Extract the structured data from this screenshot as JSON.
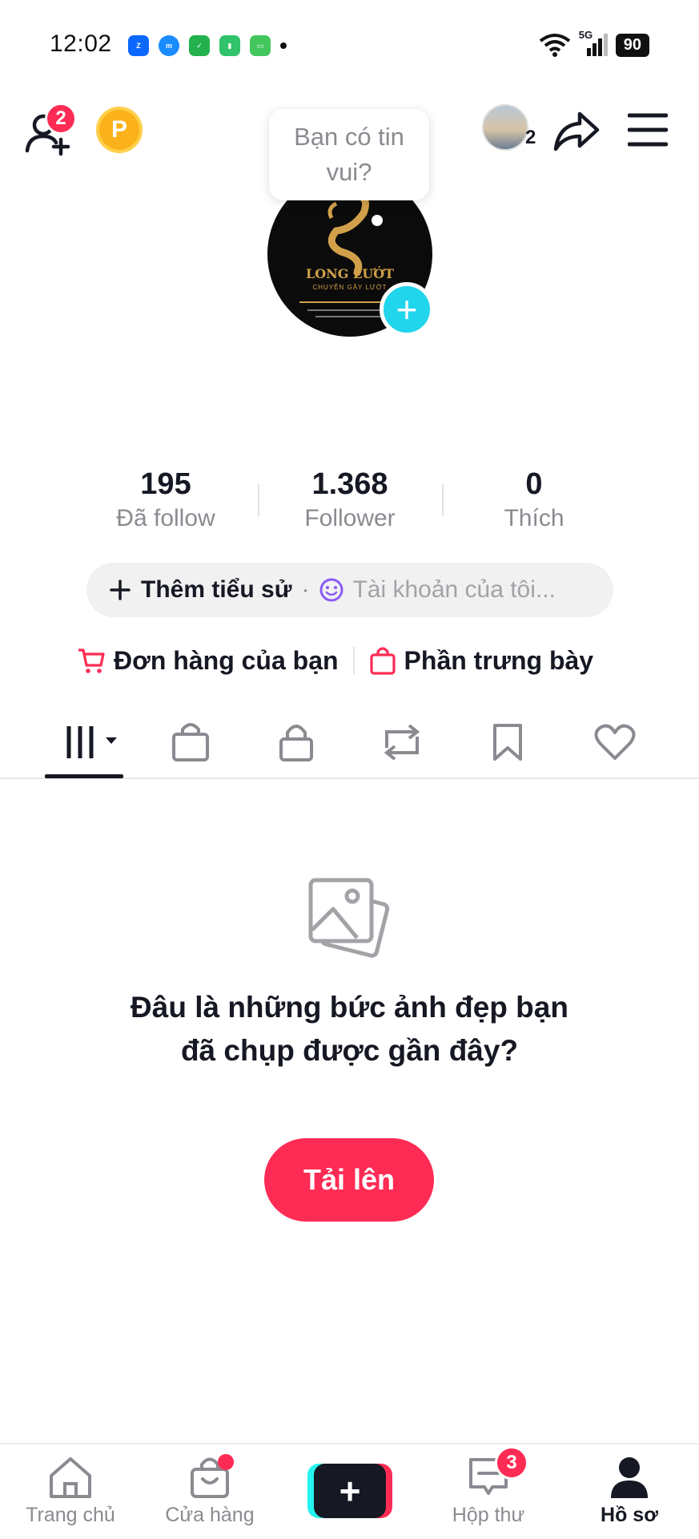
{
  "status_bar": {
    "time": "12:02",
    "battery": "90",
    "network": "5G"
  },
  "header": {
    "friend_request_badge": "2",
    "coin_label": "P",
    "accounts_count": "2"
  },
  "tooltip": {
    "text": "Bạn có tin vui?"
  },
  "avatar": {
    "brand": "LONG LƯỚT",
    "subtitle": "CHUYÊN GẬY LƯỚT"
  },
  "stats": [
    {
      "value": "195",
      "label": "Đã follow"
    },
    {
      "value": "1.368",
      "label": "Follower"
    },
    {
      "value": "0",
      "label": "Thích"
    }
  ],
  "bio": {
    "add_label": "Thêm tiểu sử",
    "separator": "·",
    "account_label": "Tài khoản của tôi..."
  },
  "shop": {
    "orders_label": "Đơn hàng của bạn",
    "showcase_label": "Phần trưng bày"
  },
  "tabs": [
    "videos-grid",
    "shop",
    "private",
    "reposts",
    "favorites",
    "liked"
  ],
  "empty_state": {
    "message": "Đâu là những bức ảnh đẹp bạn đã chụp được gần đây?",
    "upload_label": "Tải lên"
  },
  "bottom_nav": {
    "home": "Trang chủ",
    "shop": "Cửa hàng",
    "inbox": "Hộp thư",
    "inbox_badge": "3",
    "profile": "Hồ sơ"
  },
  "colors": {
    "accent": "#fe2c55",
    "cyan": "#20d5ec",
    "text": "#161823",
    "muted": "#8a8b91"
  }
}
